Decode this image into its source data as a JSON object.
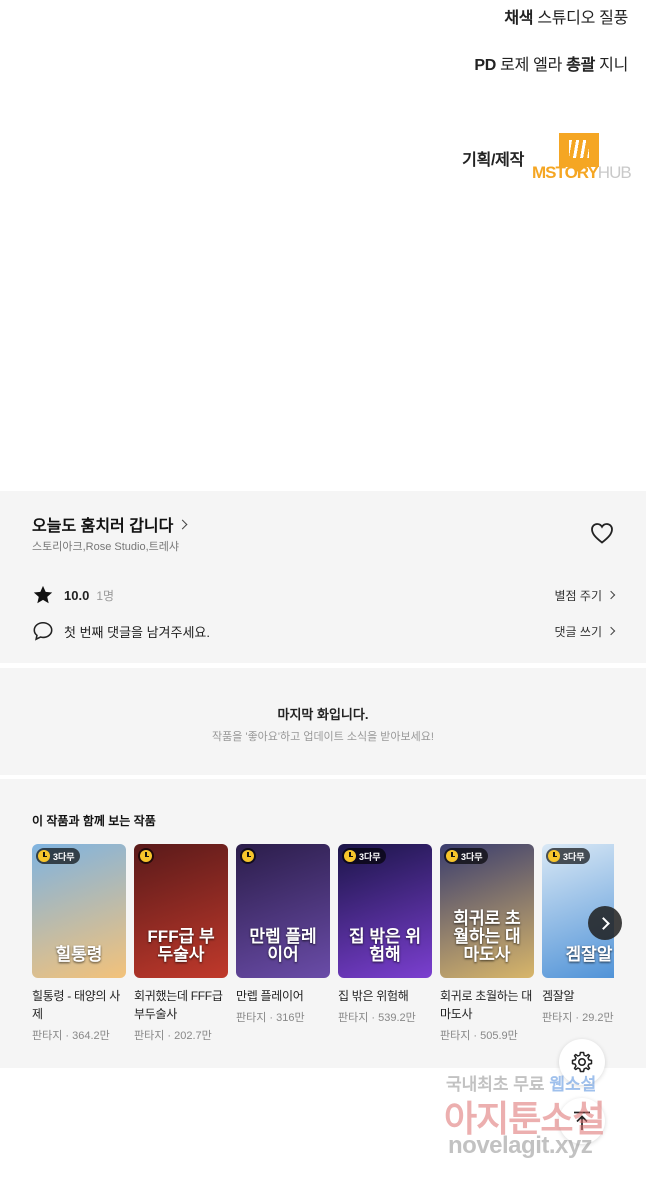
{
  "credits": {
    "coloring_role": "채색",
    "coloring_name": "스튜디오 질풍",
    "pd_role": "PD",
    "pd_name_1": "로제 엘라",
    "pd_director_role": "총괄",
    "pd_name_2": "지니",
    "production_label": "기획/제작",
    "logo_main": "MSTORY",
    "logo_hub": "HUB"
  },
  "series": {
    "title": "오늘도 훔치러 갑니다",
    "authors": "스토리아크,Rose Studio,트레샤",
    "rating": "10.0",
    "rating_count": "1명",
    "rate_action": "별점 주기",
    "comment_prompt": "첫 번째 댓글을 남겨주세요.",
    "comment_action": "댓글 쓰기"
  },
  "last_episode": {
    "title": "마지막 화입니다.",
    "subtitle": "작품을 '좋아요'하고 업데이트 소식을 받아보세요!"
  },
  "recommendations": {
    "heading": "이 작품과 함께 보는 작품",
    "items": [
      {
        "title": "힐통령 - 태양의 사제",
        "meta": "판타지 · 364.2만",
        "badge": "3다무",
        "cover_text": "힐통령",
        "colors": [
          "#7fb3e0",
          "#f3c27a"
        ]
      },
      {
        "title": "회귀했는데 FFF급 부두술사",
        "meta": "판타지 · 202.7만",
        "badge": "",
        "cover_text": "FFF급 부두술사",
        "colors": [
          "#5a1a1a",
          "#c0392b"
        ]
      },
      {
        "title": "만렙 플레이어",
        "meta": "판타지 · 316만",
        "badge": "",
        "cover_text": "만렙 플레이어",
        "colors": [
          "#2b1d4a",
          "#6a4ca8"
        ]
      },
      {
        "title": "집 밖은 위험해",
        "meta": "판타지 · 539.2만",
        "badge": "3다무",
        "cover_text": "집 밖은 위험해",
        "colors": [
          "#1b1548",
          "#7b3fd0"
        ]
      },
      {
        "title": "회귀로 초월하는 대마도사",
        "meta": "판타지 · 505.9만",
        "badge": "3다무",
        "cover_text": "회귀로 초월하는 대마도사",
        "colors": [
          "#3a3d6e",
          "#d8b66a"
        ]
      },
      {
        "title": "겜잘알",
        "meta": "판타지 · 29.2만",
        "badge": "3다무",
        "cover_text": "겜잘알",
        "colors": [
          "#d9e8f5",
          "#4a8fd6"
        ]
      }
    ]
  },
  "watermark": {
    "line1_a": "국내최초 무료",
    "line1_b": "웹소설",
    "line2": "아지툰소설",
    "line3": "novelagit.xyz"
  }
}
